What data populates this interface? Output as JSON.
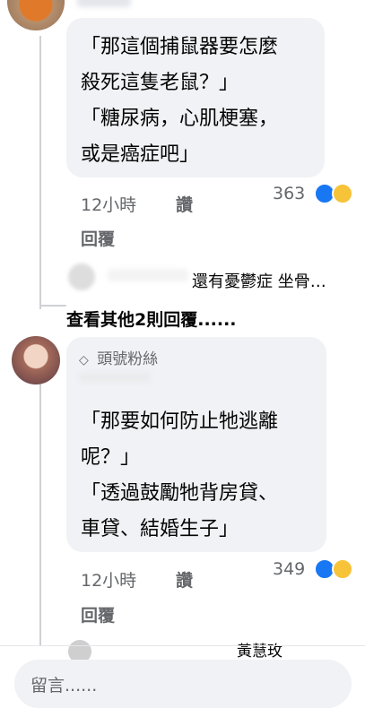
{
  "comment1": {
    "lines": [
      "「那這個捕鼠器要怎麼",
      "殺死這隻老鼠？」",
      "「糖尿病，心肌梗塞，",
      "或是癌症吧」"
    ],
    "time": "12小時",
    "like_label": "讚",
    "reply_label": "回覆",
    "reaction_count": "363"
  },
  "reply_preview": {
    "text": "還有憂鬱症 坐骨…"
  },
  "view_more": {
    "label": "查看其他2則回覆......"
  },
  "comment2": {
    "badge_label": "頭號粉絲",
    "lines": [
      "「那要如何防止牠逃離",
      "呢？」",
      "「透過鼓勵牠背房貸、",
      "車貸、結婚生子」"
    ],
    "time": "12小時",
    "like_label": "讚",
    "reply_label": "回覆",
    "reaction_count": "349"
  },
  "reply_preview2": {
    "text": "黃慧玫"
  },
  "composer": {
    "placeholder": "留言......"
  },
  "colors": {
    "like": "#1877f2",
    "haha": "#f7c338",
    "bubble": "#f0f2f5",
    "meta": "#65676b"
  },
  "icons": [
    "like-icon",
    "haha-icon",
    "diamond-icon"
  ]
}
